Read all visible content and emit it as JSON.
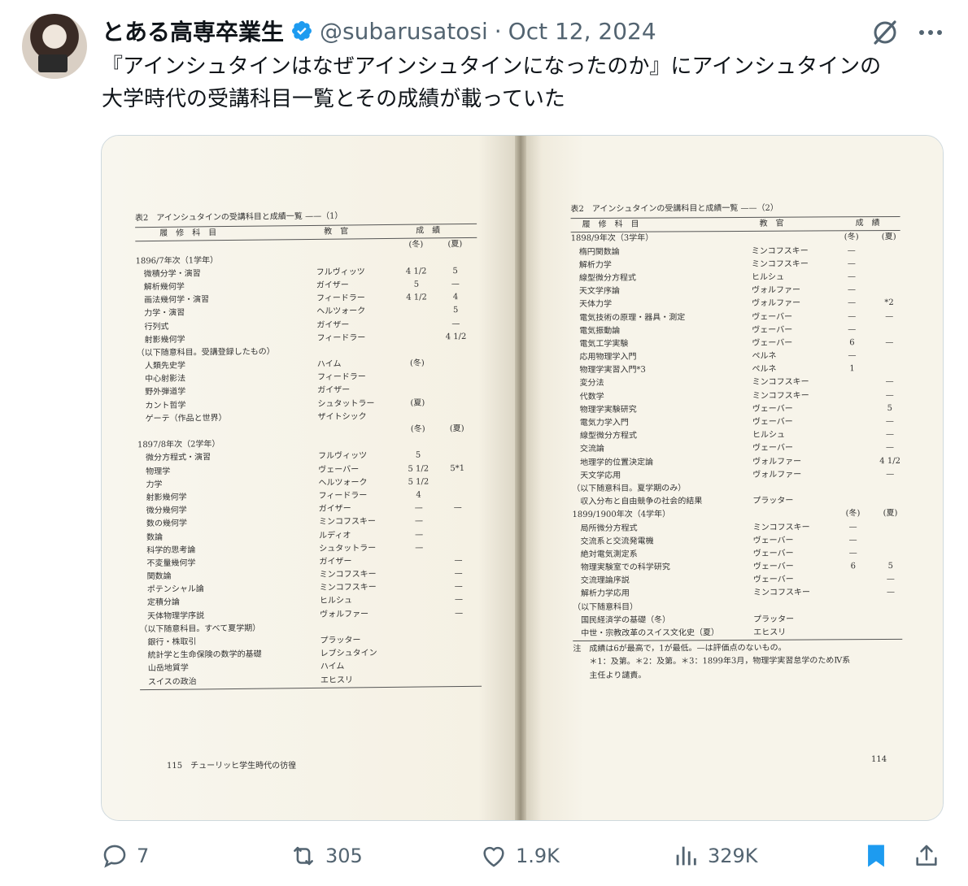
{
  "author": {
    "name": "とある高専卒業生",
    "handle": "@subarusatosi",
    "separator": "·",
    "date": "Oct 12, 2024"
  },
  "tweet_text_line1": "『アインシュタインはなぜアインシュタインになったのか』にアインシュタインの",
  "tweet_text_line2": "大学時代の受講科目一覧とその成績が載っていた",
  "left_page": {
    "title": "表2　アインシュタインの受講科目と成績一覧 ——（1）",
    "h_subject": "履　修　科　目",
    "h_teacher": "教　官",
    "h_grade": "成　績",
    "rows": [
      {
        "s": "",
        "t": "",
        "w": "(冬)",
        "su": "(夏)"
      },
      {
        "s": "1896/7年次（1学年）",
        "t": "",
        "w": "",
        "su": ""
      },
      {
        "s": "　微積分学・演習",
        "t": "フルヴィッツ",
        "w": "4 1/2",
        "su": "5"
      },
      {
        "s": "　解析幾何学",
        "t": "ガイザー",
        "w": "5",
        "su": "—"
      },
      {
        "s": "　画法幾何学・演習",
        "t": "フィードラー",
        "w": "4 1/2",
        "su": "4"
      },
      {
        "s": "　力学・演習",
        "t": "ヘルツォーク",
        "w": "",
        "su": "5"
      },
      {
        "s": "　行列式",
        "t": "ガイザー",
        "w": "",
        "su": "—"
      },
      {
        "s": "　射影幾何学",
        "t": "フィードラー",
        "w": "",
        "su": "4 1/2"
      },
      {
        "s": "（以下随意科目。受講登録したもの）",
        "t": "",
        "w": "",
        "su": ""
      },
      {
        "s": "　人類先史学",
        "t": "ハイム",
        "w": "(冬)",
        "su": ""
      },
      {
        "s": "　中心射影法",
        "t": "フィードラー",
        "w": "",
        "su": ""
      },
      {
        "s": "　野外弾道学",
        "t": "ガイザー",
        "w": "",
        "su": ""
      },
      {
        "s": "　カント哲学",
        "t": "シュタットラー",
        "w": "(夏)",
        "su": ""
      },
      {
        "s": "　ゲーテ（作品と世界）",
        "t": "ザイトシック",
        "w": "",
        "su": ""
      },
      {
        "s": "",
        "t": "",
        "w": "(冬)",
        "su": "(夏)"
      },
      {
        "s": "1897/8年次（2学年）",
        "t": "",
        "w": "",
        "su": ""
      },
      {
        "s": "　微分方程式・演習",
        "t": "フルヴィッツ",
        "w": "5",
        "su": ""
      },
      {
        "s": "　物理学",
        "t": "ヴェーバー",
        "w": "5 1/2",
        "su": "5*1"
      },
      {
        "s": "　力学",
        "t": "ヘルツォーク",
        "w": "5 1/2",
        "su": ""
      },
      {
        "s": "　射影幾何学",
        "t": "フィードラー",
        "w": "4",
        "su": ""
      },
      {
        "s": "　微分幾何学",
        "t": "ガイザー",
        "w": "—",
        "su": "—"
      },
      {
        "s": "　数の幾何学",
        "t": "ミンコフスキー",
        "w": "—",
        "su": ""
      },
      {
        "s": "　数論",
        "t": "ルディオ",
        "w": "—",
        "su": ""
      },
      {
        "s": "　科学的思考論",
        "t": "シュタットラー",
        "w": "—",
        "su": ""
      },
      {
        "s": "　不変量幾何学",
        "t": "ガイザー",
        "w": "",
        "su": "—"
      },
      {
        "s": "　関数論",
        "t": "ミンコフスキー",
        "w": "",
        "su": "—"
      },
      {
        "s": "　ポテンシャル論",
        "t": "ミンコフスキー",
        "w": "",
        "su": "—"
      },
      {
        "s": "　定積分論",
        "t": "ヒルシュ",
        "w": "",
        "su": "—"
      },
      {
        "s": "　天体物理学序説",
        "t": "ヴォルファー",
        "w": "",
        "su": "—"
      },
      {
        "s": "（以下随意科目。すべて夏学期）",
        "t": "",
        "w": "",
        "su": ""
      },
      {
        "s": "　銀行・株取引",
        "t": "プラッター",
        "w": "",
        "su": ""
      },
      {
        "s": "　統計学と生命保険の数学的基礎",
        "t": "レブシュタイン",
        "w": "",
        "su": ""
      },
      {
        "s": "　山岳地質学",
        "t": "ハイム",
        "w": "",
        "su": ""
      },
      {
        "s": "　スイスの政治",
        "t": "エヒスリ",
        "w": "",
        "su": ""
      }
    ],
    "footer": "115　チューリッヒ学生時代の彷徨"
  },
  "right_page": {
    "title": "表2　アインシュタインの受講科目と成績一覧 ——（2）",
    "h_subject": "履　修　科　目",
    "h_teacher": "教　官",
    "h_grade": "成　績",
    "rows": [
      {
        "s": "1898/9年次（3学年）",
        "t": "",
        "w": "(冬)",
        "su": "(夏)"
      },
      {
        "s": "　楕円関数論",
        "t": "ミンコフスキー",
        "w": "—",
        "su": ""
      },
      {
        "s": "　解析力学",
        "t": "ミンコフスキー",
        "w": "—",
        "su": ""
      },
      {
        "s": "　線型微分方程式",
        "t": "ヒルシュ",
        "w": "—",
        "su": ""
      },
      {
        "s": "　天文学序論",
        "t": "ヴォルファー",
        "w": "—",
        "su": ""
      },
      {
        "s": "　天体力学",
        "t": "ヴォルファー",
        "w": "—",
        "su": "*2"
      },
      {
        "s": "　電気技術の原理・器具・測定",
        "t": "ヴェーバー",
        "w": "—",
        "su": "—"
      },
      {
        "s": "　電気振動論",
        "t": "ヴェーバー",
        "w": "—",
        "su": ""
      },
      {
        "s": "　電気工学実験",
        "t": "ヴェーバー",
        "w": "6",
        "su": "—"
      },
      {
        "s": "　応用物理学入門",
        "t": "ペルネ",
        "w": "—",
        "su": ""
      },
      {
        "s": "　物理学実習入門*3",
        "t": "ペルネ",
        "w": "1",
        "su": ""
      },
      {
        "s": "　変分法",
        "t": "ミンコフスキー",
        "w": "",
        "su": "—"
      },
      {
        "s": "　代数学",
        "t": "ミンコフスキー",
        "w": "",
        "su": "—"
      },
      {
        "s": "　物理学実験研究",
        "t": "ヴェーバー",
        "w": "",
        "su": "5"
      },
      {
        "s": "　電気力学入門",
        "t": "ヴェーバー",
        "w": "",
        "su": "—"
      },
      {
        "s": "　線型微分方程式",
        "t": "ヒルシュ",
        "w": "",
        "su": "—"
      },
      {
        "s": "　交流論",
        "t": "ヴェーバー",
        "w": "",
        "su": "—"
      },
      {
        "s": "　地理学的位置決定論",
        "t": "ヴォルファー",
        "w": "",
        "su": "4 1/2"
      },
      {
        "s": "　天文学応用",
        "t": "ヴォルファー",
        "w": "",
        "su": "—"
      },
      {
        "s": "（以下随意科目。夏学期のみ）",
        "t": "",
        "w": "",
        "su": ""
      },
      {
        "s": "　収入分布と自由競争の社会的結果",
        "t": "プラッター",
        "w": "",
        "su": ""
      },
      {
        "s": "1899/1900年次（4学年）",
        "t": "",
        "w": "(冬)",
        "su": "(夏)"
      },
      {
        "s": "　局所微分方程式",
        "t": "ミンコフスキー",
        "w": "—",
        "su": ""
      },
      {
        "s": "　交流系と交流発電機",
        "t": "ヴェーバー",
        "w": "—",
        "su": ""
      },
      {
        "s": "　絶対電気測定系",
        "t": "ヴェーバー",
        "w": "—",
        "su": ""
      },
      {
        "s": "　物理実験室での科学研究",
        "t": "ヴェーバー",
        "w": "6",
        "su": "5"
      },
      {
        "s": "　交流理論序説",
        "t": "ヴェーバー",
        "w": "",
        "su": "—"
      },
      {
        "s": "　解析力学応用",
        "t": "ミンコフスキー",
        "w": "",
        "su": "—"
      },
      {
        "s": "（以下随意科目）",
        "t": "",
        "w": "",
        "su": ""
      },
      {
        "s": "　国民経済学の基礎（冬）",
        "t": "プラッター",
        "w": "",
        "su": ""
      },
      {
        "s": "　中世・宗教改革のスイス文化史（夏）",
        "t": "エヒスリ",
        "w": "",
        "su": ""
      }
    ],
    "note1": "注　成績は6が最高で，1が最低。—は評価点のないもの。",
    "note2": "　　＊1：及第。＊2：及第。＊3：1899年3月，物理学実習怠学のためⅣ系",
    "note3": "　　主任より譴責。",
    "footer": "114"
  },
  "actions": {
    "replies": "7",
    "retweets": "305",
    "likes": "1.9K",
    "views": "329K"
  },
  "colors": {
    "text": "#0f1419",
    "secondary": "#536471",
    "verified": "#1d9bf0",
    "bookmark": "#1d9bf0"
  },
  "icons": [
    "verified-badge-icon",
    "grok-icon",
    "more-icon",
    "reply-icon",
    "retweet-icon",
    "like-icon",
    "views-icon",
    "bookmark-icon",
    "share-icon"
  ]
}
